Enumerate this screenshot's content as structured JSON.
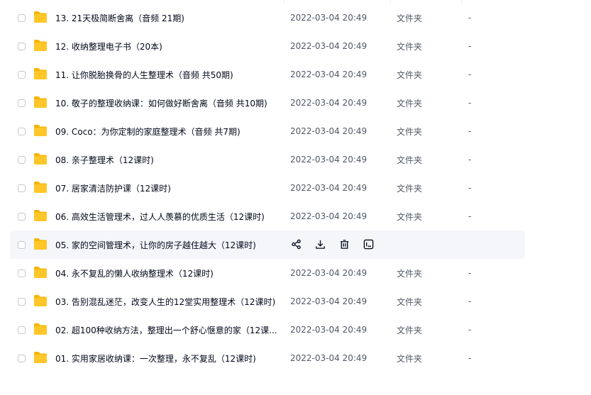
{
  "rows": [
    {
      "name": "13. 21天极简断舍离（音频 21期)",
      "date": "2022-03-04 20:49",
      "type": "文件夹",
      "size": "-"
    },
    {
      "name": "12. 收纳整理电子书（20本)",
      "date": "2022-03-04 20:49",
      "type": "文件夹",
      "size": "-"
    },
    {
      "name": "11.  让你脱胎换骨的人生整理术（音频 共50期)",
      "date": "2022-03-04 20:49",
      "type": "文件夹",
      "size": "-"
    },
    {
      "name": "10. 敬子的整理收纳课：如何做好断舍离（音频 共10期)",
      "date": "2022-03-04 20:49",
      "type": "文件夹",
      "size": "-"
    },
    {
      "name": "09. Coco：为你定制的家庭整理术（音频 共7期)",
      "date": "2022-03-04 20:49",
      "type": "文件夹",
      "size": "-"
    },
    {
      "name": "08. 亲子整理术（12课时)",
      "date": "2022-03-04 20:49",
      "type": "文件夹",
      "size": "-"
    },
    {
      "name": "07. 居家清洁防护课（12课时)",
      "date": "2022-03-04 20:49",
      "type": "文件夹",
      "size": "-"
    },
    {
      "name": "06. 高效生活管理术，过人人羡慕的优质生活（12课时)",
      "date": "2022-03-04 20:49",
      "type": "文件夹",
      "size": "-"
    },
    {
      "name": "05. 家的空间管理术，让你的房子越住越大（12课时)",
      "hover": true
    },
    {
      "name": "04. 永不复乱的懒人收纳整理术（12课时)",
      "date": "2022-03-04 20:49",
      "type": "文件夹",
      "size": "-"
    },
    {
      "name": "03. 告别混乱迷茫，改变人生的12堂实用整理术（12课时)",
      "date": "2022-03-04 20:49",
      "type": "文件夹",
      "size": "-"
    },
    {
      "name": "02. 超100种收纳方法，整理出一个舒心惬意的家（12课...",
      "date": "2022-03-04 20:49",
      "type": "文件夹",
      "size": "-"
    },
    {
      "name": "01. 实用家居收纳课：一次整理，永不复乱（12课时)",
      "date": "2022-03-04 20:49",
      "type": "文件夹",
      "size": "-"
    }
  ],
  "icons": {
    "folder": "folder-icon",
    "share": "share-icon",
    "download": "download-icon",
    "delete": "trash-icon",
    "more": "more-icon"
  },
  "colors": {
    "folder": "#ffc629",
    "folder_dark": "#f5b300",
    "hover_bg": "#f5f6fa",
    "text_secondary": "#525866",
    "icon": "#03081a"
  }
}
